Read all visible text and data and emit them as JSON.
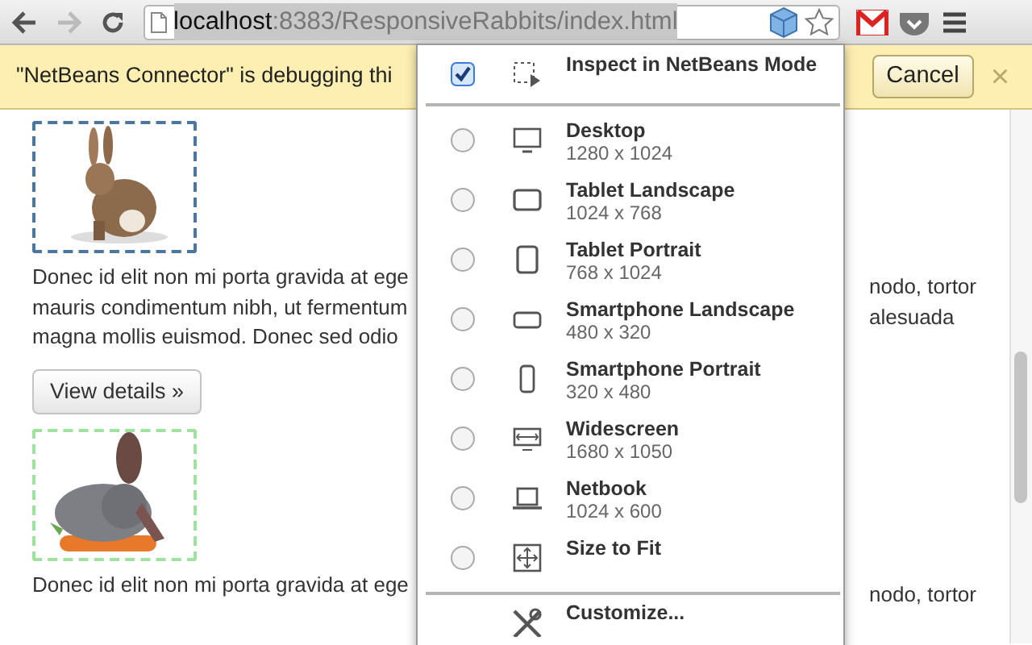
{
  "toolbar": {
    "back_disabled": false,
    "forward_disabled": true,
    "url_host": "localhost",
    "url_rest": ":8383/ResponsiveRabbits/index.html",
    "url_selected": true
  },
  "infobar": {
    "message": "\"NetBeans Connector\" is debugging thi",
    "button": "Cancel",
    "close": "×"
  },
  "content": {
    "items": [
      {
        "kind": "picture",
        "color": "#4a76a0"
      },
      {
        "kind": "paragraph",
        "lines_left": [
          "Donec id elit non mi porta gravida at ege",
          "mauris condimentum nibh, ut fermentum",
          "magna mollis euismod. Donec sed odio"
        ],
        "lines_right": [
          "nodo, tortor",
          "alesuada"
        ]
      },
      {
        "kind": "button",
        "label": "View details »"
      },
      {
        "kind": "picture",
        "color": "#9ee29e"
      },
      {
        "kind": "paragraph",
        "lines_left": [
          "Donec id elit non mi porta gravida at ege"
        ],
        "lines_right": [
          "nodo, tortor"
        ]
      }
    ]
  },
  "popup": {
    "items": [
      {
        "kind": "checkbox",
        "label": "Inspect in NetBeans Mode",
        "checked": true
      },
      {
        "kind": "divider"
      },
      {
        "kind": "radio",
        "label": "Desktop",
        "size": "1280 x 1024",
        "selected": false
      },
      {
        "kind": "radio",
        "label": "Tablet Landscape",
        "size": "1024 x 768",
        "selected": false
      },
      {
        "kind": "radio",
        "label": "Tablet Portrait",
        "size": "768 x 1024",
        "selected": false
      },
      {
        "kind": "radio",
        "label": "Smartphone Landscape",
        "size": "480 x 320",
        "selected": false
      },
      {
        "kind": "radio",
        "label": "Smartphone Portrait",
        "size": "320 x 480",
        "selected": false
      },
      {
        "kind": "radio",
        "label": "Widescreen",
        "size": "1680 x 1050",
        "selected": false
      },
      {
        "kind": "radio",
        "label": "Netbook",
        "size": "1024 x 600",
        "selected": false
      },
      {
        "kind": "radio",
        "label": "Size to Fit",
        "selected": false
      },
      {
        "kind": "divider"
      },
      {
        "kind": "action",
        "label": "Customize..."
      }
    ]
  }
}
